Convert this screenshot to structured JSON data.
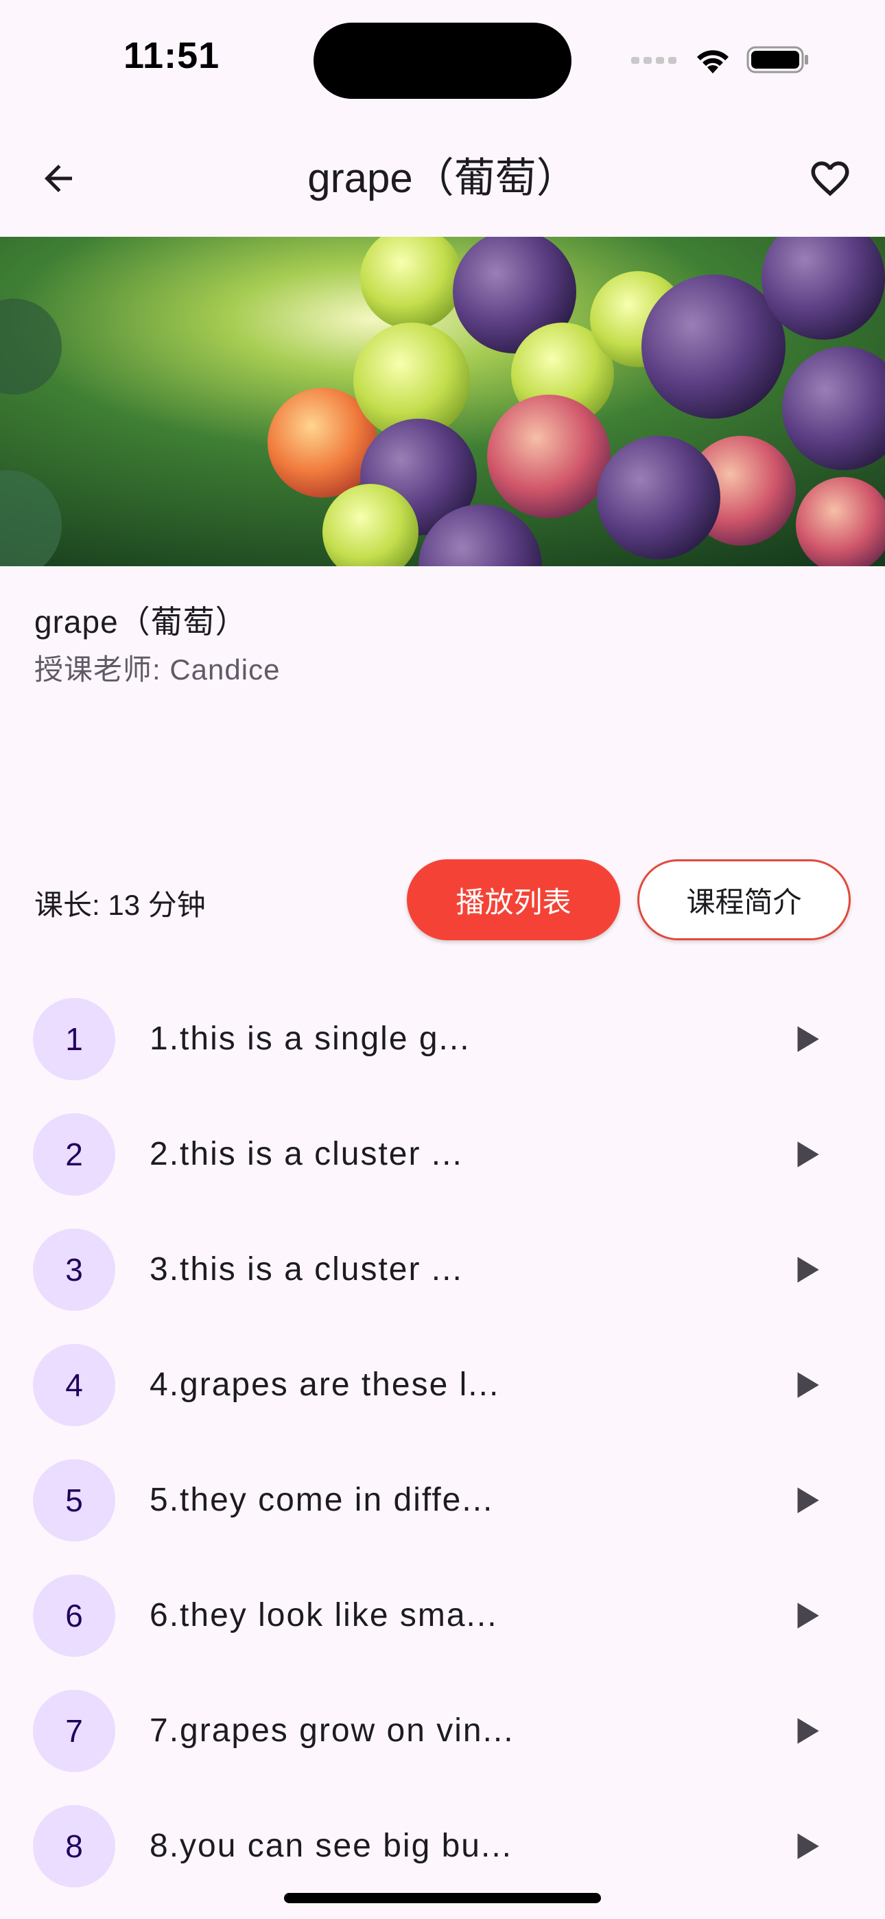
{
  "status_bar": {
    "time": "11:51"
  },
  "app_bar": {
    "title": "grape（葡萄）",
    "back_icon": "arrow-left-icon",
    "favorite_icon": "heart-outline-icon"
  },
  "course": {
    "title": "grape（葡萄）",
    "teacher": "授课老师: Candice",
    "duration": "课长: 13 分钟"
  },
  "buttons": {
    "playlist_label": "播放列表",
    "intro_label": "课程简介"
  },
  "colors": {
    "accent_red": "#f44336",
    "number_badge_bg": "#eaddff",
    "number_badge_fg": "#21005d",
    "background": "#fdf7fd"
  },
  "lessons": [
    {
      "number": "1",
      "text": "1.this is a single g..."
    },
    {
      "number": "2",
      "text": "2.this is a cluster ..."
    },
    {
      "number": "3",
      "text": "3.this is a cluster ..."
    },
    {
      "number": "4",
      "text": "4.grapes are these l..."
    },
    {
      "number": "5",
      "text": "5.they come in diffe..."
    },
    {
      "number": "6",
      "text": "6.they look like sma..."
    },
    {
      "number": "7",
      "text": "7.grapes grow on vin..."
    },
    {
      "number": "8",
      "text": "8.you can see big bu..."
    }
  ]
}
